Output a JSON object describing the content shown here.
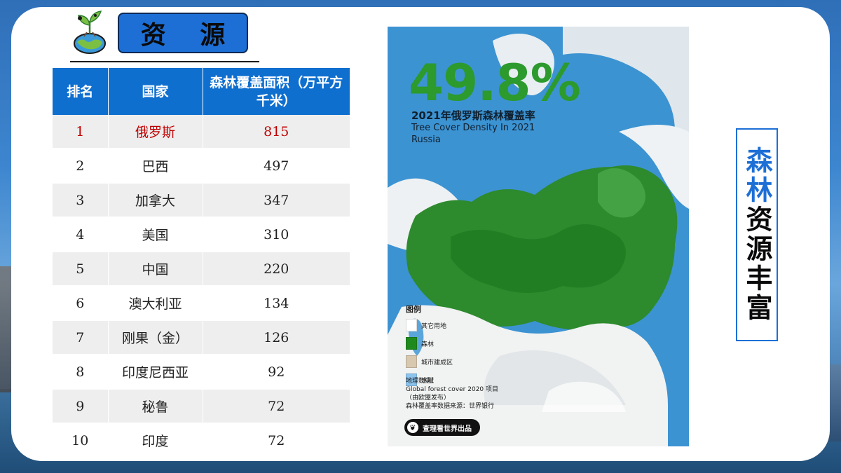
{
  "header": {
    "title": "资 源"
  },
  "table": {
    "columns": [
      "排名",
      "国家",
      "森林覆盖面积（万平方千米）"
    ],
    "rows": [
      {
        "rank": "1",
        "country": "俄罗斯",
        "area": "815"
      },
      {
        "rank": "2",
        "country": "巴西",
        "area": "497"
      },
      {
        "rank": "3",
        "country": "加拿大",
        "area": "347"
      },
      {
        "rank": "4",
        "country": "美国",
        "area": "310"
      },
      {
        "rank": "5",
        "country": "中国",
        "area": "220"
      },
      {
        "rank": "6",
        "country": "澳大利亚",
        "area": "134"
      },
      {
        "rank": "7",
        "country": "刚果（金）",
        "area": "126"
      },
      {
        "rank": "8",
        "country": "印度尼西亚",
        "area": "92"
      },
      {
        "rank": "9",
        "country": "秘鲁",
        "area": "72"
      },
      {
        "rank": "10",
        "country": "印度",
        "area": "72"
      }
    ]
  },
  "map": {
    "percent": "49.8%",
    "title_cn": "2021年俄罗斯森林覆盖率",
    "title_en": "Tree Cover Density In 2021 Russia",
    "legend_title": "图例",
    "legend": [
      {
        "label": "其它用地",
        "color": "#ffffff"
      },
      {
        "label": "森林",
        "color": "#1e8a1e"
      },
      {
        "label": "城市建成区",
        "color": "#d8c8b0"
      },
      {
        "label": "水域",
        "color": "#8cc4ee"
      }
    ],
    "source_lines": [
      "地理数据：",
      "Global forest cover 2020 项目",
      "（由欧盟发布）",
      "森林覆盖率数据来源：世界银行"
    ],
    "brand": "查理看世界出品"
  },
  "side": {
    "blue_part": "森林",
    "black_part": "资源丰富"
  },
  "colors": {
    "accent": "#1d6fd6",
    "header_bg": "#0f6fcf",
    "highlight": "#c00000",
    "forest": "#2c9a2c"
  },
  "icons": {
    "logo": "globe-sprout-icon",
    "brand": "leaf-icon"
  }
}
